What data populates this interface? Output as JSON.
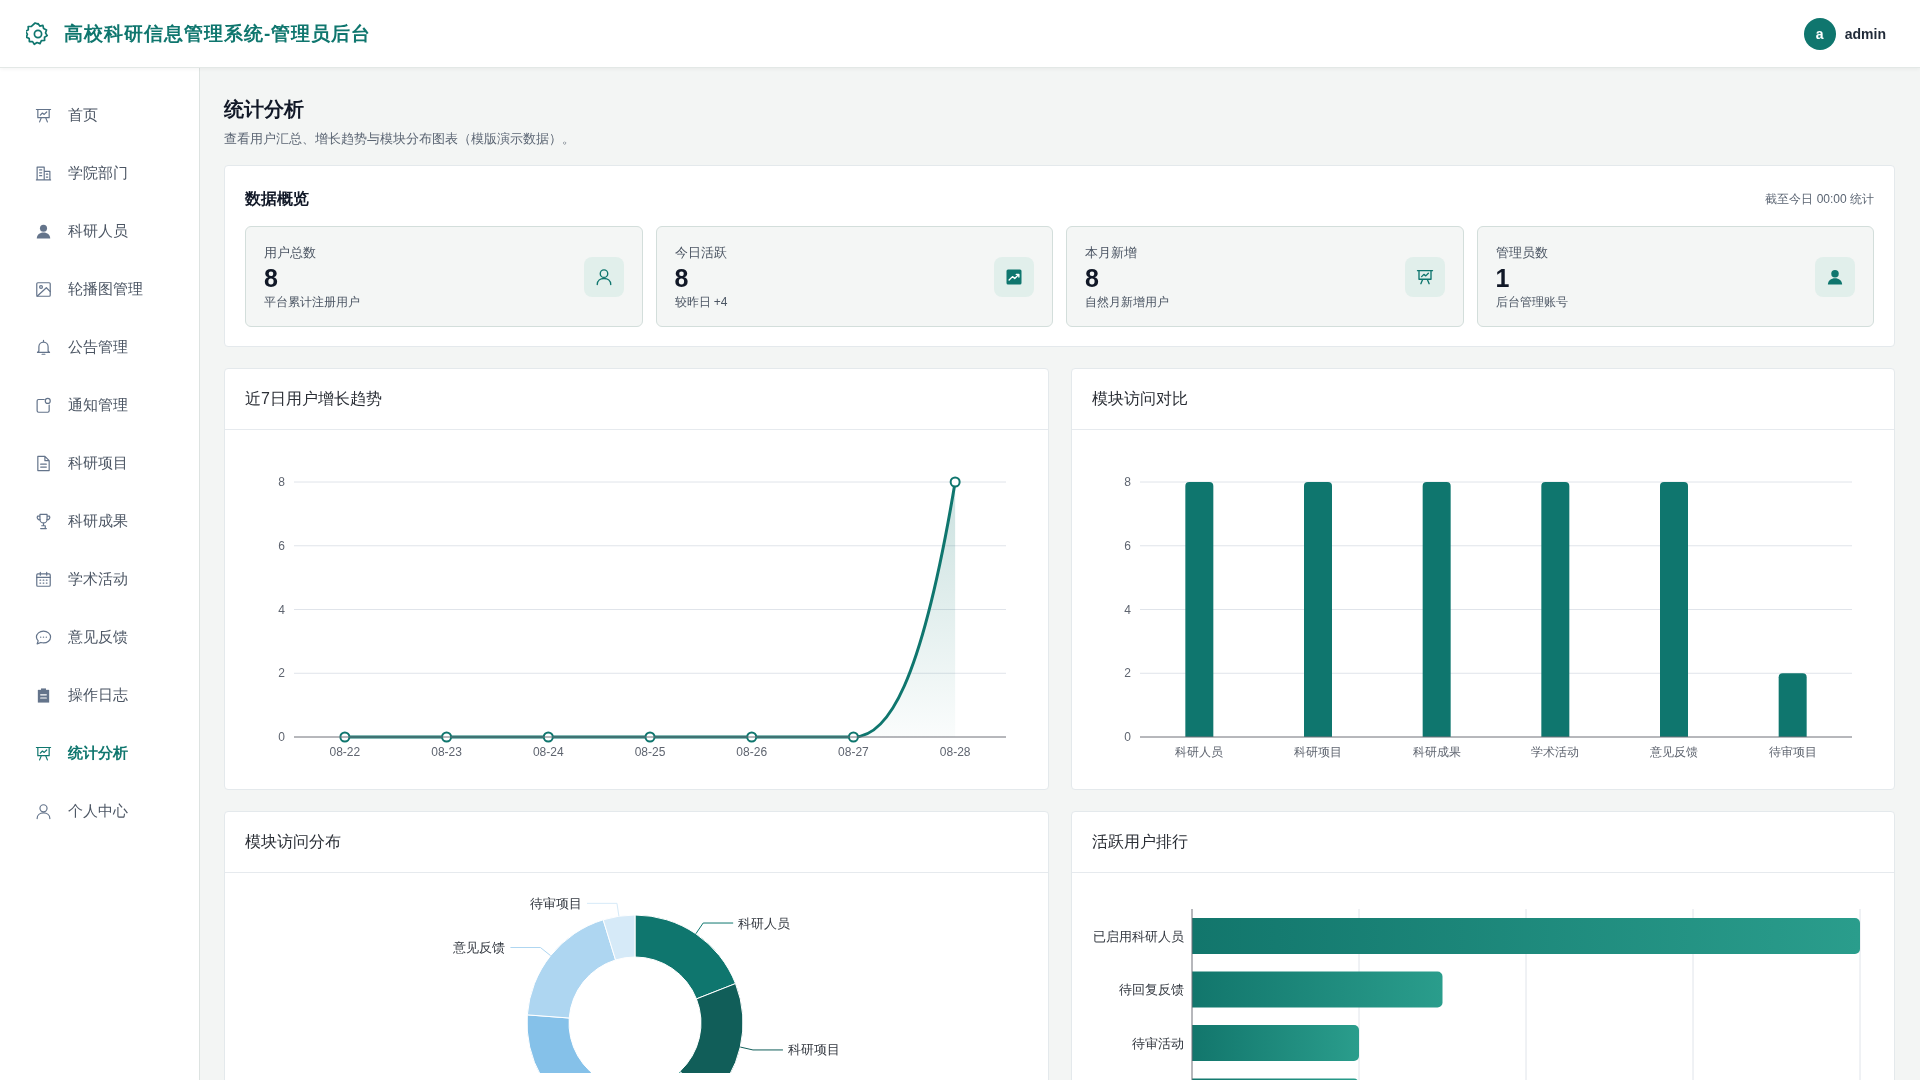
{
  "header": {
    "title": "高校科研信息管理系统-管理员后台",
    "user": {
      "avatar": "a",
      "name": "admin"
    }
  },
  "sidebar": {
    "items": [
      {
        "label": "首页",
        "selected": false
      },
      {
        "label": "学院部门",
        "selected": false
      },
      {
        "label": "科研人员",
        "selected": false
      },
      {
        "label": "轮播图管理",
        "selected": false
      },
      {
        "label": "公告管理",
        "selected": false
      },
      {
        "label": "通知管理",
        "selected": false
      },
      {
        "label": "科研项目",
        "selected": false
      },
      {
        "label": "科研成果",
        "selected": false
      },
      {
        "label": "学术活动",
        "selected": false
      },
      {
        "label": "意见反馈",
        "selected": false
      },
      {
        "label": "操作日志",
        "selected": false
      },
      {
        "label": "统计分析",
        "selected": true
      },
      {
        "label": "个人中心",
        "selected": false
      }
    ]
  },
  "page": {
    "title": "统计分析",
    "subtitle": "查看用户汇总、增长趋势与模块分布图表（模版演示数据）。"
  },
  "overview": {
    "title": "数据概览",
    "note": "截至今日 00:00 统计",
    "stats": [
      {
        "label": "用户总数",
        "value": "8",
        "sub": "平台累计注册用户"
      },
      {
        "label": "今日活跃",
        "value": "8",
        "sub": "较昨日 +4"
      },
      {
        "label": "本月新增",
        "value": "8",
        "sub": "自然月新增用户"
      },
      {
        "label": "管理员数",
        "value": "1",
        "sub": "后台管理账号"
      }
    ]
  },
  "growth_chart": {
    "title": "近7日用户增长趋势",
    "chart_data": {
      "type": "area",
      "categories": [
        "08-22",
        "08-23",
        "08-24",
        "08-25",
        "08-26",
        "08-27",
        "08-28"
      ],
      "values": [
        0,
        0,
        0,
        0,
        0,
        0,
        8
      ],
      "ylim": [
        0,
        8
      ],
      "yticks": [
        0,
        2,
        4,
        6,
        8
      ],
      "grid": true,
      "marker": true
    }
  },
  "module_chart": {
    "title": "模块访问对比",
    "chart_data": {
      "type": "bar",
      "categories": [
        "科研人员",
        "科研项目",
        "科研成果",
        "学术活动",
        "意见反馈",
        "待审项目"
      ],
      "values": [
        8,
        8,
        8,
        8,
        8,
        2
      ],
      "ylim": [
        0,
        8
      ],
      "yticks": [
        0,
        2,
        4,
        6,
        8
      ],
      "grid": true
    }
  },
  "distribution_chart": {
    "title": "模块访问分布",
    "chart_data": {
      "type": "donut",
      "categories": [
        "科研人员",
        "科研项目",
        null,
        null,
        "意见反馈",
        "待审项目"
      ],
      "values": [
        19.05,
        19.05,
        19.05,
        19.05,
        19.04,
        4.76
      ]
    }
  },
  "ranking": {
    "title": "活跃用户排行",
    "items": [
      {
        "label": "已启用科研人员"
      },
      {
        "label": "待回复反馈"
      },
      {
        "label": "待审活动"
      }
    ]
  }
}
